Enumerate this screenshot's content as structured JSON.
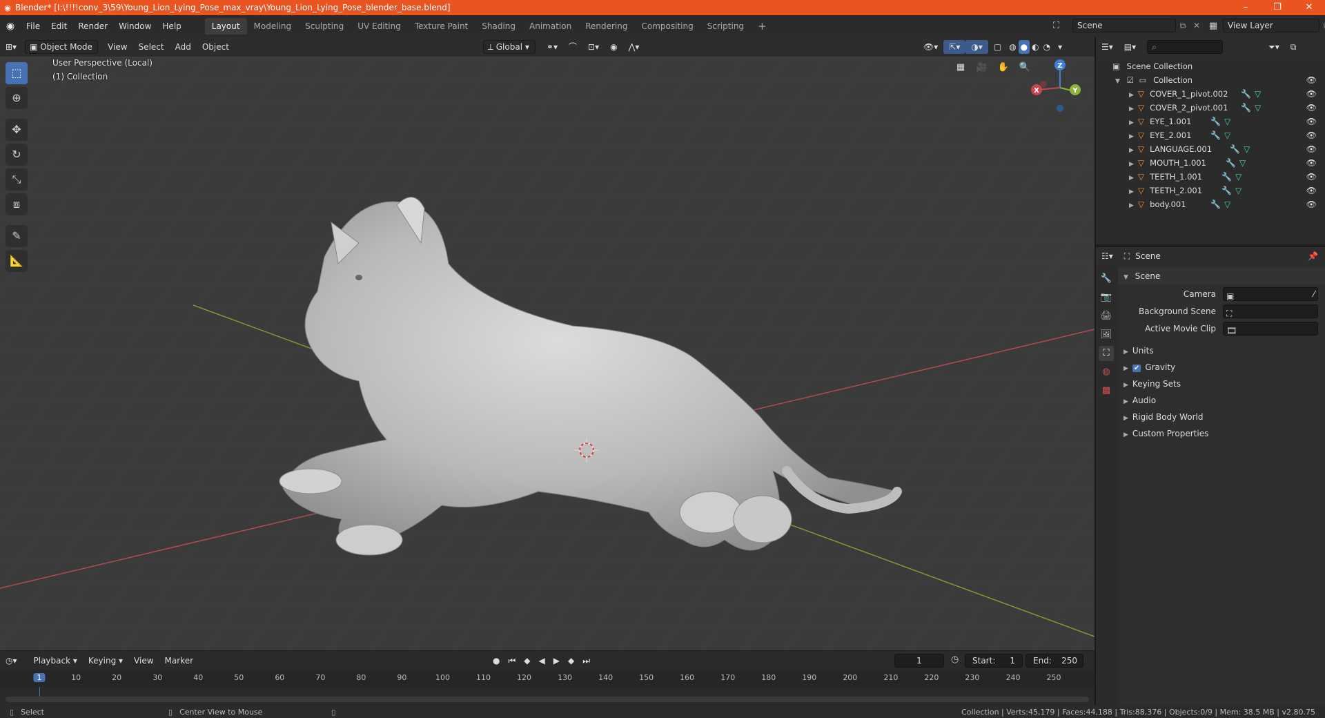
{
  "window": {
    "title": "Blender* [I:\\!!!!conv_3\\59\\Young_Lion_Lying_Pose_max_vray\\Young_Lion_Lying_Pose_blender_base.blend]",
    "minimize": "–",
    "maximize": "❐",
    "close": "✕"
  },
  "menu": [
    "File",
    "Edit",
    "Render",
    "Window",
    "Help"
  ],
  "workspaces": [
    "Layout",
    "Modeling",
    "Sculpting",
    "UV Editing",
    "Texture Paint",
    "Shading",
    "Animation",
    "Rendering",
    "Compositing",
    "Scripting",
    "+"
  ],
  "top_right": {
    "scene": "Scene",
    "view_layer": "View Layer"
  },
  "header3d": {
    "mode": "Object Mode",
    "menus": [
      "View",
      "Select",
      "Add",
      "Object"
    ],
    "orientation": "Global"
  },
  "viewport": {
    "perspective": "User Perspective (Local)",
    "collection": "(1) Collection",
    "gizmo": {
      "x": "X",
      "y": "Y",
      "z": "Z"
    }
  },
  "outliner": {
    "root": "Scene Collection",
    "collection": "Collection",
    "items": [
      "COVER_1_pivot.002",
      "COVER_2_pivot.001",
      "EYE_1.001",
      "EYE_2.001",
      "LANGUAGE.001",
      "MOUTH_1.001",
      "TEETH_1.001",
      "TEETH_2.001",
      "body.001"
    ]
  },
  "properties": {
    "header": "Scene",
    "panel": "Scene",
    "fields": [
      {
        "label": "Camera"
      },
      {
        "label": "Background Scene"
      },
      {
        "label": "Active Movie Clip"
      }
    ],
    "sections": [
      "Units",
      "Gravity",
      "Keying Sets",
      "Audio",
      "Rigid Body World",
      "Custom Properties"
    ]
  },
  "timeline": {
    "menus": [
      "Playback",
      "Keying",
      "View",
      "Marker"
    ],
    "current_frame": "1",
    "start_label": "Start:",
    "start": "1",
    "end_label": "End:",
    "end": "250",
    "ticks": [
      "1",
      "10",
      "20",
      "30",
      "40",
      "50",
      "60",
      "70",
      "80",
      "90",
      "100",
      "110",
      "120",
      "130",
      "140",
      "150",
      "160",
      "170",
      "180",
      "190",
      "200",
      "210",
      "220",
      "230",
      "240",
      "250"
    ]
  },
  "status": {
    "left1": "Select",
    "left2": "Center View to Mouse",
    "right": "Collection | Verts:45,179 | Faces:44,188 | Tris:88,376 | Objects:0/9 | Mem: 38.5 MB | v2.80.75"
  },
  "colors": {
    "accent": "#4772b3",
    "titlebar": "#e95420",
    "x_axis": "#c8464e",
    "y_axis": "#8cb33a",
    "z_axis": "#3f81d6"
  }
}
